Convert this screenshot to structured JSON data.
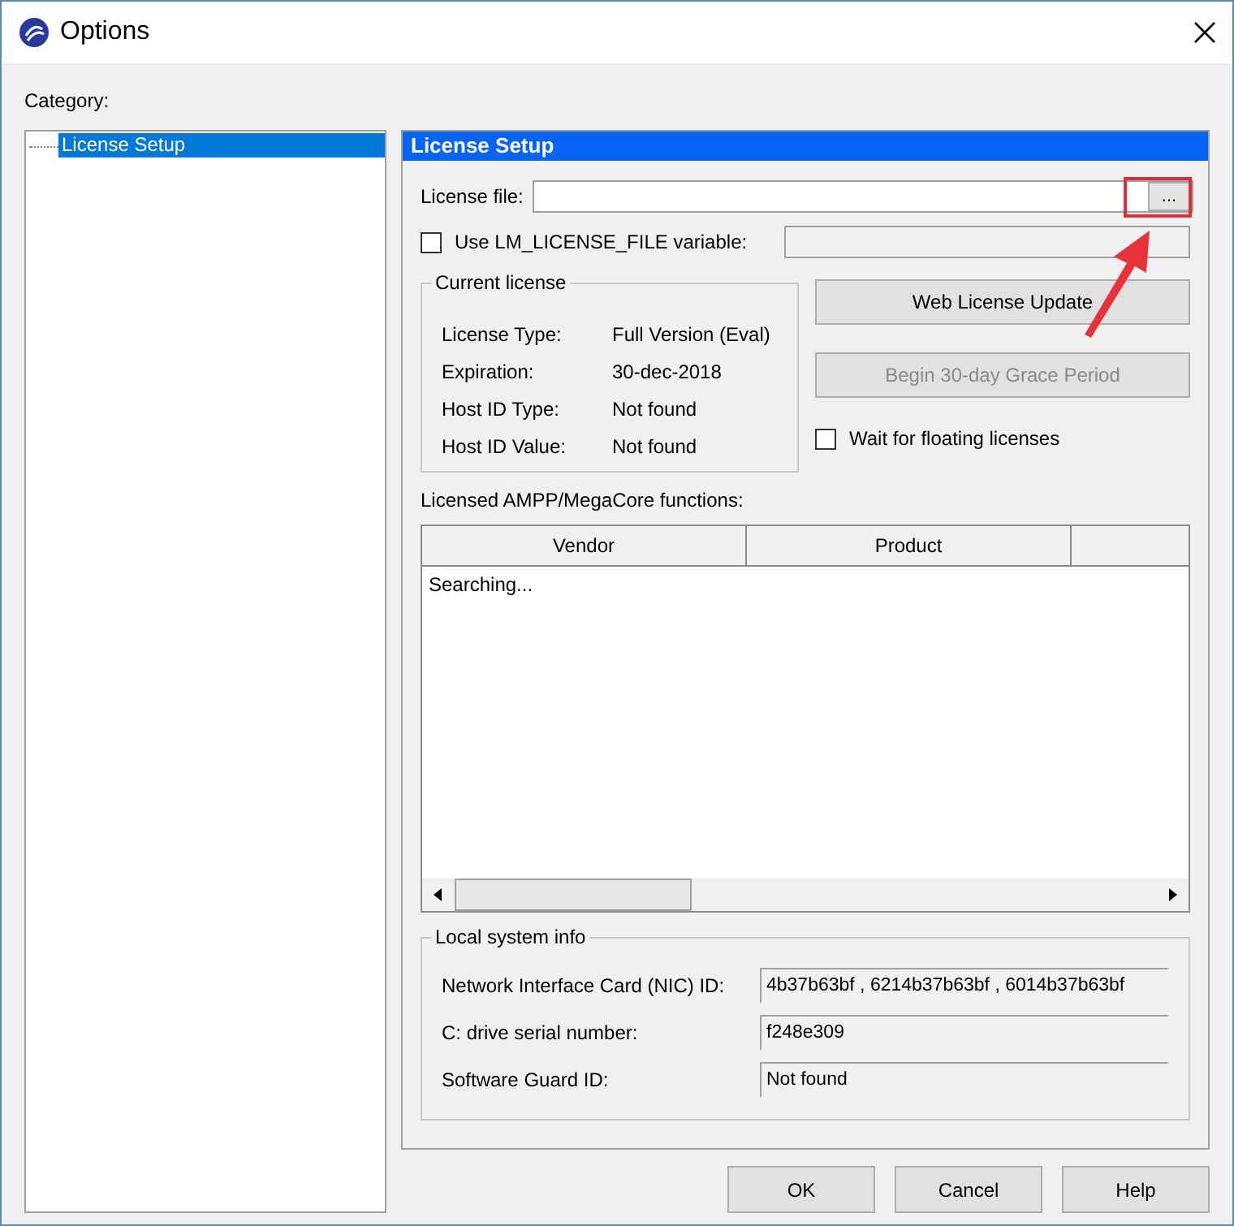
{
  "window": {
    "title": "Options"
  },
  "category": {
    "label": "Category:",
    "items": [
      {
        "label": "License Setup",
        "selected": true
      }
    ]
  },
  "panel": {
    "title": "License Setup",
    "license_file": {
      "label": "License file:",
      "browse": "..."
    },
    "use_variable": {
      "label": "Use LM_LICENSE_FILE variable:",
      "checked": false
    },
    "current_license": {
      "title": "Current license",
      "rows": [
        {
          "label": "License Type:",
          "value": "Full Version (Eval)"
        },
        {
          "label": "Expiration:",
          "value": "30-dec-2018"
        },
        {
          "label": "Host ID Type:",
          "value": "Not found"
        },
        {
          "label": "Host ID Value:",
          "value": "Not found"
        }
      ]
    },
    "actions": [
      {
        "label": "Web License Update",
        "disabled": false
      },
      {
        "label": "Begin 30-day Grace Period",
        "disabled": true
      }
    ],
    "wait_floating": {
      "label": "Wait for floating licenses",
      "checked": false
    },
    "functions": {
      "label": "Licensed AMPP/MegaCore functions:",
      "columns": [
        "Vendor",
        "Product"
      ],
      "message": "Searching..."
    },
    "local_info": {
      "title": "Local system info",
      "rows": [
        {
          "label": "Network Interface Card (NIC) ID:",
          "value": "4b37b63bf , 6214b37b63bf , 6014b37b63bf"
        },
        {
          "label": "C: drive serial number:",
          "value": "f248e309"
        },
        {
          "label": "Software Guard ID:",
          "value": "Not found"
        }
      ]
    }
  },
  "buttons": [
    "OK",
    "Cancel",
    "Help"
  ]
}
